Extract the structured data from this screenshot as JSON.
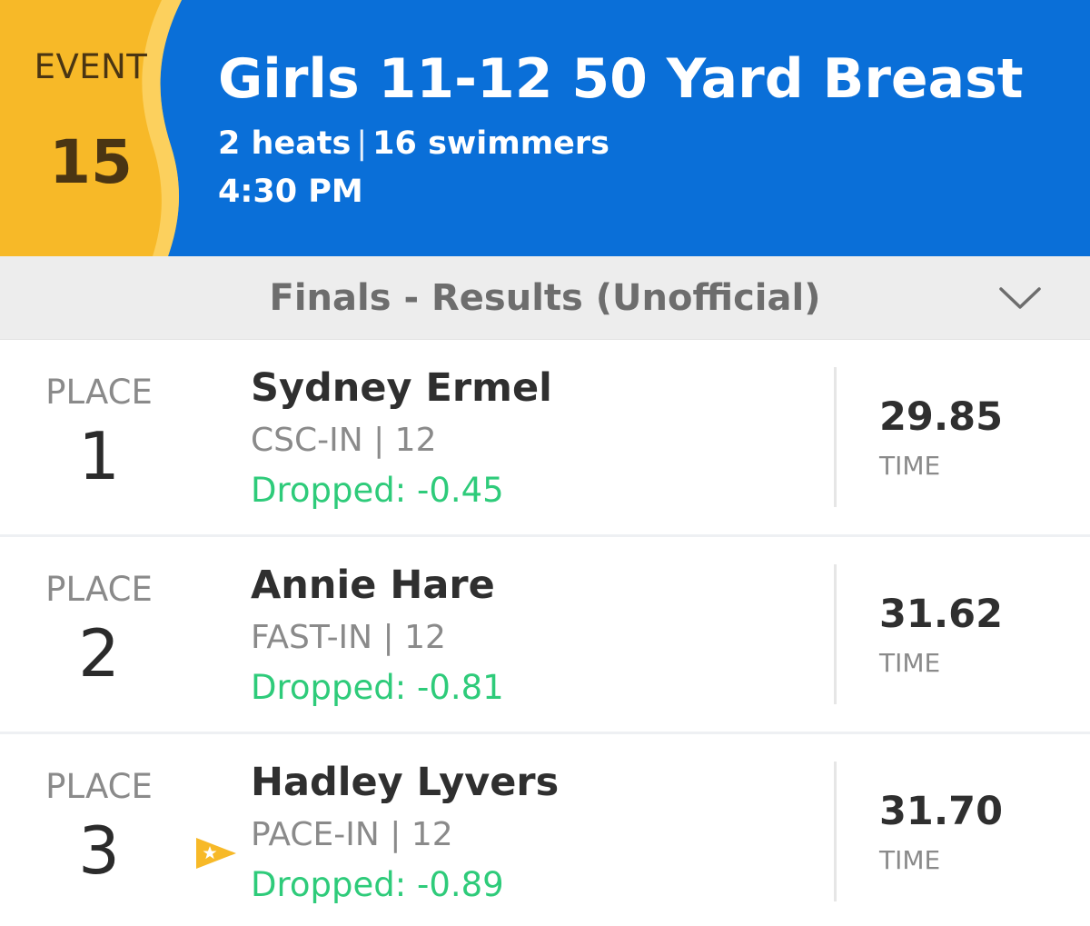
{
  "event": {
    "label": "EVENT",
    "number": "15",
    "title": "Girls 11-12 50 Yard Breast",
    "heats": "2 heats",
    "separator": "|",
    "swimmers": "16 swimmers",
    "time": "4:30 PM"
  },
  "section": {
    "title": "Finals - Results (Unofficial)",
    "toggle_icon": "chevron-down-icon"
  },
  "results": [
    {
      "place_label": "PLACE",
      "place": "1",
      "name": "Sydney Ermel",
      "team": "CSC-IN | 12",
      "dropped": "Dropped: -0.45",
      "time": "29.85",
      "time_label": "TIME"
    },
    {
      "place_label": "PLACE",
      "place": "2",
      "name": "Annie Hare",
      "team": "FAST-IN | 12",
      "dropped": "Dropped: -0.81",
      "time": "31.62",
      "time_label": "TIME"
    },
    {
      "place_label": "PLACE",
      "place": "3",
      "name": "Hadley Lyvers",
      "team": "PACE-IN | 12",
      "dropped": "Dropped: -0.89",
      "time": "31.70",
      "time_label": "TIME",
      "badge_icon": "star-flag-icon"
    }
  ],
  "colors": {
    "header_blue": "#0a6fd8",
    "badge_gold": "#f7b928",
    "dropped_green": "#2ecb7a"
  }
}
